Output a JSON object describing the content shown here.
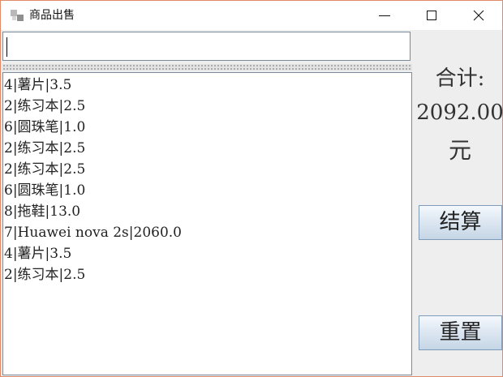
{
  "window": {
    "title": "商品出售",
    "icons": {
      "app": "app-icon",
      "minimize": "minimize-icon",
      "maximize": "maximize-icon",
      "close": "close-icon"
    }
  },
  "input": {
    "value": ""
  },
  "list": {
    "items": [
      "4|薯片|3.5",
      "2|练习本|2.5",
      "6|圆珠笔|1.0",
      "2|练习本|2.5",
      "2|练习本|2.5",
      "6|圆珠笔|1.0",
      "8|拖鞋|13.0",
      "7|Huawei nova 2s|2060.0",
      "4|薯片|3.5",
      "2|练习本|2.5"
    ]
  },
  "summary": {
    "total_label": "合计:",
    "total_value": "2092.00",
    "unit": "元"
  },
  "buttons": {
    "checkout": "结算",
    "reset": "重置"
  }
}
